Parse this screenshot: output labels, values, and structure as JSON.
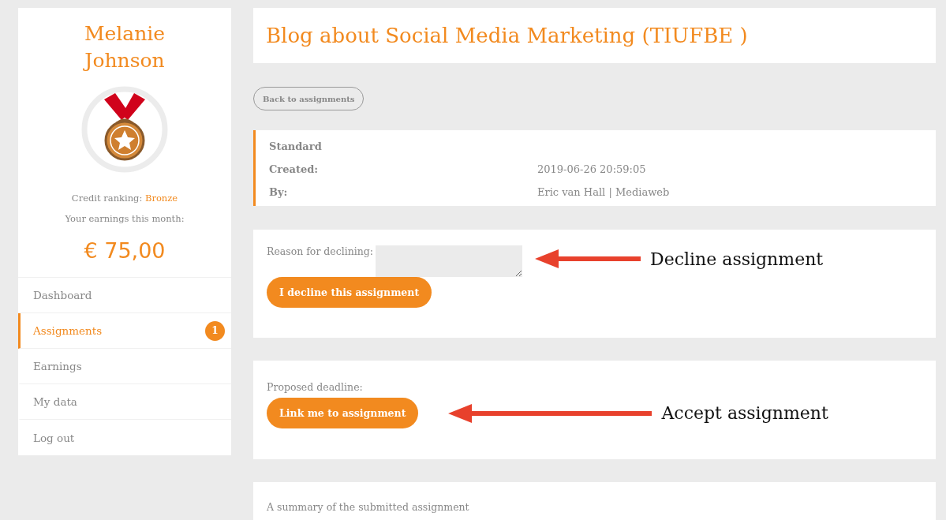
{
  "profile": {
    "name": "Melanie Johnson",
    "ranking_label": "Credit ranking:",
    "ranking": "Bronze",
    "earnings_label": "Your earnings this month:",
    "earnings": "€ 75,00"
  },
  "nav": [
    {
      "label": "Dashboard",
      "selected": false
    },
    {
      "label": "Assignments",
      "selected": true,
      "badge": "1"
    },
    {
      "label": "Earnings",
      "selected": false
    },
    {
      "label": "My data",
      "selected": false
    },
    {
      "label": "Log out",
      "selected": false
    }
  ],
  "title": "Blog about Social Media Marketing (TIUFBE )",
  "back_button": "Back to assignments",
  "info": {
    "type": "Standard",
    "rows": [
      {
        "label": "Created:",
        "value": "2019-06-26 20:59:05"
      },
      {
        "label": "By:",
        "value": "Eric van Hall | Mediaweb"
      }
    ]
  },
  "decline": {
    "label": "Reason for declining:",
    "button": "I decline this assignment",
    "annotation": "Decline assignment"
  },
  "accept": {
    "label": "Proposed deadline:",
    "button": "Link me to assignment",
    "annotation": "Accept assignment"
  },
  "summary": {
    "label": "A summary of the submitted assignment"
  }
}
